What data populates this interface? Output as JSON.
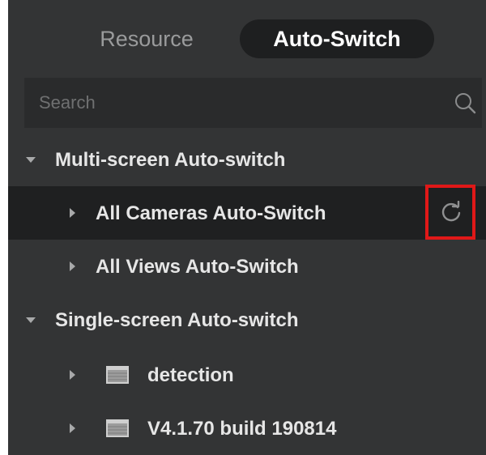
{
  "tabs": [
    {
      "label": "Resource",
      "active": false
    },
    {
      "label": "Auto-Switch",
      "active": true
    }
  ],
  "search": {
    "placeholder": "Search"
  },
  "tree": {
    "multi": {
      "label": "Multi-screen Auto-switch",
      "children": [
        {
          "label": "All Cameras Auto-Switch",
          "selected": true
        },
        {
          "label": "All Views Auto-Switch",
          "selected": false
        }
      ]
    },
    "single": {
      "label": "Single-screen Auto-switch",
      "children": [
        {
          "label": "detection",
          "icon": "folder-icon"
        },
        {
          "label": "V4.1.70 build 190814",
          "icon": "folder-icon"
        }
      ]
    }
  },
  "colors": {
    "panel_bg": "#333435",
    "active_tab_bg": "#1e1f20",
    "highlight_box": "#e01818"
  },
  "icons": {
    "search": "search-icon",
    "refresh": "refresh-icon",
    "expand": "caret-down-icon",
    "collapse": "caret-right-icon"
  }
}
